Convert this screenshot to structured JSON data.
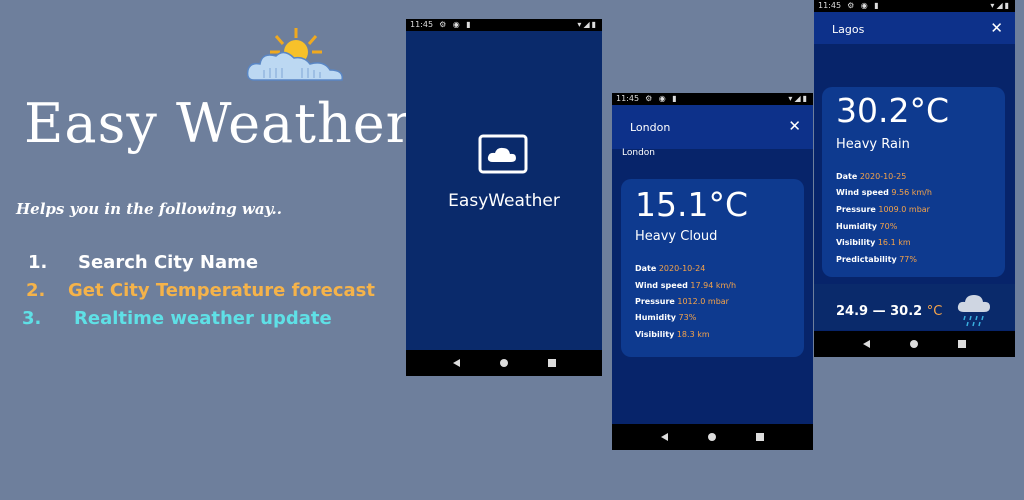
{
  "promo": {
    "title": "Easy Weather",
    "tagline": "Helps you in the following way..",
    "features": [
      {
        "num": "1.",
        "text": "Search City Name",
        "color": "#ffffff"
      },
      {
        "num": "2.",
        "text": "Get City Temperature forecast",
        "color": "#f5b34a"
      },
      {
        "num": "3.",
        "text": "Realtime weather update",
        "color": "#5fe0e6"
      }
    ]
  },
  "phone1": {
    "status_time": "11:45",
    "app_name": "EasyWeather"
  },
  "phone2": {
    "status_time": "11:45",
    "search_value": "London",
    "city_label": "London",
    "temperature": "15.1°C",
    "condition": "Heavy Cloud",
    "details": [
      {
        "label": "Date",
        "value": "2020-10-24"
      },
      {
        "label": "Wind speed",
        "value": "17.94 km/h"
      },
      {
        "label": "Pressure",
        "value": "1012.0 mbar"
      },
      {
        "label": "Humidity",
        "value": "73%"
      },
      {
        "label": "Visibility",
        "value": "18.3 km"
      }
    ]
  },
  "phone3": {
    "status_time": "11:45",
    "search_value": "Lagos",
    "temperature": "30.2°C",
    "condition": "Heavy Rain",
    "details": [
      {
        "label": "Date",
        "value": "2020-10-25"
      },
      {
        "label": "Wind speed",
        "value": "9.56 km/h"
      },
      {
        "label": "Pressure",
        "value": "1009.0 mbar"
      },
      {
        "label": "Humidity",
        "value": "70%"
      },
      {
        "label": "Visibility",
        "value": "16.1 km"
      },
      {
        "label": "Predictability",
        "value": "77%"
      }
    ],
    "range": "24.9 — 30.2",
    "range_unit": "°C"
  },
  "icons": {
    "logo": "sun-cloud-icon",
    "close": "close-icon",
    "rain": "rain-cloud-icon",
    "app": "cloud-screen-icon"
  },
  "colors": {
    "background": "#6e7f9c",
    "phone_bg": "#0a2a6b",
    "card_bg": "#0e3a8f",
    "accent": "#f5a34a"
  }
}
